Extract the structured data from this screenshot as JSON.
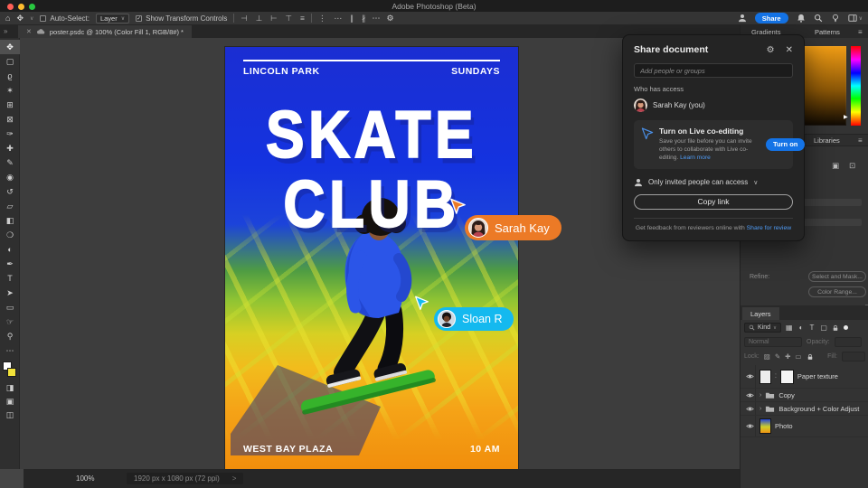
{
  "titlebar": {
    "title": "Adobe Photoshop (Beta)"
  },
  "options_bar": {
    "home_icon": "⌂",
    "tool_glyph": "✥",
    "caret": "∨",
    "auto_select_label": "Auto-Select:",
    "auto_select_value": "Layer",
    "check_glyph": "✓",
    "show_transform_label": "Show Transform Controls",
    "align_icons": [
      {
        "name": "align-left-icon",
        "glyph": "⊣"
      },
      {
        "name": "align-center-horizontal-icon",
        "glyph": "⊥"
      },
      {
        "name": "align-right-icon",
        "glyph": "⊢"
      },
      {
        "name": "align-top-icon",
        "glyph": "⊤"
      },
      {
        "name": "align-bottom-icon",
        "glyph": "≡"
      }
    ],
    "distribute_icons": [
      {
        "name": "distribute-vertical-icon",
        "glyph": "⋮"
      },
      {
        "name": "distribute-horizontal-icon",
        "glyph": "⋯"
      },
      {
        "name": "distribute-left-edges-icon",
        "glyph": "∥"
      },
      {
        "name": "distribute-right-edges-icon",
        "glyph": "∦"
      }
    ],
    "more_icon": "⋯",
    "gear_icon": "⚙",
    "share_label": "Share"
  },
  "document_tab": {
    "collapse_glyph": "»",
    "close_glyph": "✕",
    "title": "poster.psdc @ 100% (Color Fill 1, RGB/8#) *"
  },
  "toolbar": {
    "move_tool": {
      "name": "move-tool",
      "glyph": "✥"
    },
    "tools": [
      {
        "name": "marquee-tool",
        "glyph": "▢"
      },
      {
        "name": "lasso-tool",
        "glyph": "ϱ"
      },
      {
        "name": "object-selection-tool",
        "glyph": "✶"
      },
      {
        "name": "crop-tool",
        "glyph": "⊞"
      },
      {
        "name": "frame-tool",
        "glyph": "⊠"
      },
      {
        "name": "eyedropper-tool",
        "glyph": "✑"
      },
      {
        "name": "healing-brush-tool",
        "glyph": "✚"
      },
      {
        "name": "brush-tool",
        "glyph": "✎"
      },
      {
        "name": "clone-stamp-tool",
        "glyph": "◉"
      },
      {
        "name": "history-brush-tool",
        "glyph": "↺"
      },
      {
        "name": "eraser-tool",
        "glyph": "▱"
      },
      {
        "name": "gradient-tool",
        "glyph": "◧"
      },
      {
        "name": "blur-tool",
        "glyph": "❍"
      },
      {
        "name": "dodge-tool",
        "glyph": "◐"
      },
      {
        "name": "pen-tool",
        "glyph": "✒"
      },
      {
        "name": "type-tool",
        "glyph": "T"
      },
      {
        "name": "path-select-tool",
        "glyph": "➤"
      },
      {
        "name": "shape-tool",
        "glyph": "▭"
      },
      {
        "name": "hand-tool",
        "glyph": "☞"
      },
      {
        "name": "zoom-tool",
        "glyph": "⚲"
      },
      {
        "name": "more-tools",
        "glyph": "⋯"
      }
    ],
    "bottom_tools": [
      {
        "name": "quick-mask-icon",
        "glyph": "◨"
      },
      {
        "name": "screen-mode-standard-icon",
        "glyph": "▣"
      },
      {
        "name": "screen-mode-icon",
        "glyph": "◫"
      }
    ],
    "fg_color": "#ffffff",
    "bg_color": "#f2e23a"
  },
  "poster": {
    "top_left": "LINCOLN PARK",
    "top_right": "SUNDAYS",
    "title_line1": "SKATE",
    "title_line2": "CLUB",
    "bottom_left": "WEST BAY PLAZA",
    "bottom_right": "10 AM",
    "colors": {
      "top": "#1433D6",
      "mid": "#8FC433",
      "bottom": "#F18E0C",
      "skateboard": "#36B32B"
    }
  },
  "cursors": {
    "sarah": {
      "name": "Sarah Kay",
      "color": "#EC7A26"
    },
    "sloan": {
      "name": "Sloan R",
      "color": "#14B9EF"
    }
  },
  "share_dialog": {
    "title": "Share document",
    "gear_icon": "⚙",
    "close_icon": "✕",
    "input_placeholder": "Add people or groups",
    "access_heading": "Who has access",
    "owner_name": "Sarah Kay (you)",
    "coedit": {
      "title": "Turn on Live co-editing",
      "body": "Save your file before you can invite others to collaborate with Live co-editing.",
      "link": "Learn more",
      "button": "Turn on"
    },
    "access_row": {
      "label": "Only invited people can access",
      "caret": "∨"
    },
    "copy_link_label": "Copy link",
    "footer": {
      "text": "Get feedback from reviewers online with",
      "link": "Share for review"
    }
  },
  "panels": {
    "tabs": {
      "tab1": "Gradients",
      "tab2": "Patterns",
      "menu_icon": "≡"
    },
    "libraries": {
      "label": "Libraries",
      "menu_icon": "≡"
    },
    "properties": {
      "add_mask_icon": "▣",
      "vector_mask_icon": "⊡",
      "refine_label": "Refine:",
      "select_mask_label": "Select and Mask...",
      "color_range_label": "Color Range...",
      "footer_selection_icon": "▢",
      "footer_apply_icon": "◈",
      "hue_marker": "▶"
    },
    "layers": {
      "tab_label": "Layers",
      "kind_label": "Kind",
      "caret": "∨",
      "filter_icons": [
        {
          "name": "filter-pixel-layers-icon",
          "glyph": "▦"
        },
        {
          "name": "filter-adjustment-layers-icon",
          "glyph": "◐"
        },
        {
          "name": "filter-type-layers-icon",
          "glyph": "T"
        },
        {
          "name": "filter-shape-layers-icon",
          "glyph": "▢"
        }
      ],
      "blend_mode": "Normal",
      "opacity_label": "Opacity:",
      "lock_label": "Lock:",
      "lock_icons": [
        {
          "name": "lock-transparency-icon",
          "glyph": "▨"
        },
        {
          "name": "lock-pixels-icon",
          "glyph": "✎"
        },
        {
          "name": "lock-position-icon",
          "glyph": "✚"
        },
        {
          "name": "lock-artboard-icon",
          "glyph": "▭"
        }
      ],
      "fill_label": "Fill:",
      "group_caret": "›",
      "link_glyph": "⁚",
      "items": [
        {
          "name": "Paper texture"
        },
        {
          "name": "Copy"
        },
        {
          "name": "Background + Color Adjust"
        },
        {
          "name": "Photo"
        }
      ]
    }
  },
  "status_bar": {
    "zoom": "100%",
    "dimensions": "1920 px x 1080 px (72 ppi)",
    "chevron": ">"
  }
}
